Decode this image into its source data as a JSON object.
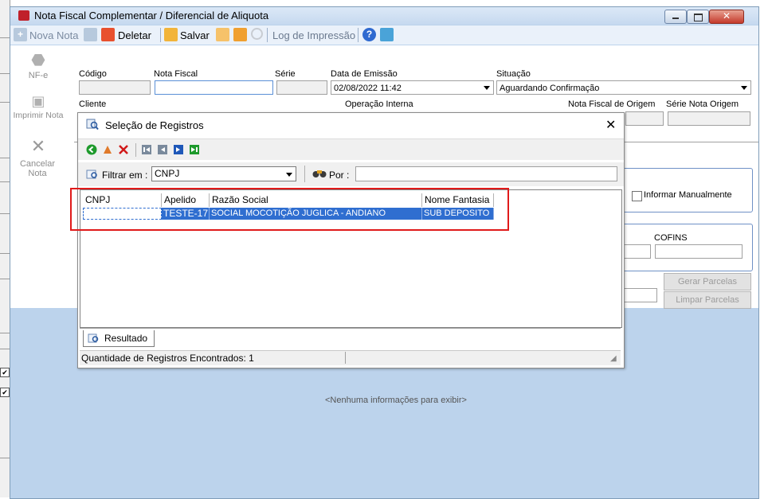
{
  "window": {
    "title": "Nota Fiscal Complementar / Diferencial de Aliquota",
    "close_glyph": "✕"
  },
  "toolbar": {
    "new_label": "Nova Nota",
    "delete_label": "Deletar",
    "save_label": "Salvar",
    "print_log_label": "Log de Impressão"
  },
  "side": {
    "nfe_label": "NF-e",
    "print_label": "Imprimir Nota",
    "cancel_label": "Cancelar Nota"
  },
  "form": {
    "codigo_label": "Código",
    "nota_fiscal_label": "Nota Fiscal",
    "serie_label": "Série",
    "data_emissao_label": "Data de Emissão",
    "data_emissao_value": "02/08/2022 11:42",
    "situacao_label": "Situação",
    "situacao_value": "Aguardando Confirmação",
    "cliente_label": "Cliente",
    "operacao_label": "Operação Interna",
    "nf_origem_label": "Nota Fiscal de Origem",
    "serie_origem_label": "Série Nota Origem",
    "informar_label": "Informar Manualmente",
    "cofins_label": "COFINS",
    "gerar_label": "Gerar Parcelas",
    "limpar_label": "Limpar Parcelas",
    "empty_text": "<Nenhuma informações para exibir>"
  },
  "dialog": {
    "title": "Seleção de Registros",
    "close_glyph": "✕",
    "filter_label": "Filtrar em :",
    "filter_value": "CNPJ",
    "por_label": "Por :",
    "por_value": "",
    "columns": [
      "CNPJ",
      "Apelido",
      "Razão Social",
      "Nome Fantasia"
    ],
    "row": {
      "cnpj": "",
      "apelido": "TESTE-17",
      "razao": "SOCIAL MOCOTIÇÃO JUGLICA - ANDIANO",
      "fantasia": "SUB DEPOSITO"
    },
    "tab_label": "Resultado",
    "status_text": "Quantidade de Registros Encontrados: 1"
  },
  "colors": {
    "selection": "#2f6ed0",
    "highlight_border": "#e01a1a"
  }
}
